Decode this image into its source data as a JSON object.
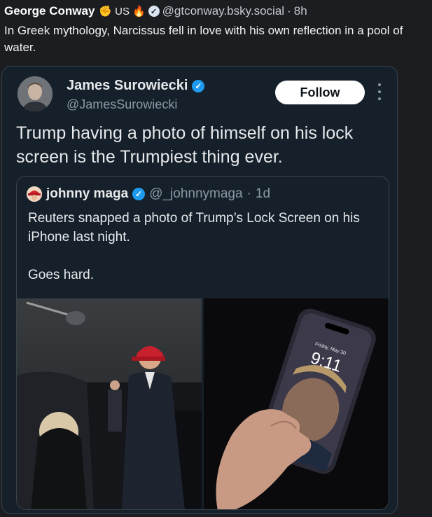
{
  "post": {
    "author_name": "George Conway",
    "country_tag": "US",
    "handle": "@gtconway.bsky.social",
    "separator": "·",
    "age": "8h",
    "text": "In Greek mythology, Narcissus fell in love with his own reflection in a pool of water."
  },
  "embed": {
    "name": "James Surowiecki",
    "handle": "@JamesSurowiecki",
    "follow_label": "Follow",
    "text": "Trump having a photo of himself on his lock screen is the Trumpiest thing ever.",
    "quote": {
      "name": "johnny maga",
      "handle": "@_johnnymaga",
      "separator": "·",
      "age": "1d",
      "text": "Reuters snapped a photo of Trump’s Lock Screen on his iPhone last night.\n\nGoes hard.",
      "phone_date": "Friday, May 30",
      "phone_time": "9:11"
    }
  },
  "colors": {
    "background": "#1b1d21",
    "card": "#15202b",
    "border": "#38444d",
    "verified_blue": "#1d9bf0"
  },
  "icons": [
    "flag-icon",
    "fire-icon",
    "verified-badge-icon",
    "more-options-icon",
    "maga-hat-icon"
  ]
}
